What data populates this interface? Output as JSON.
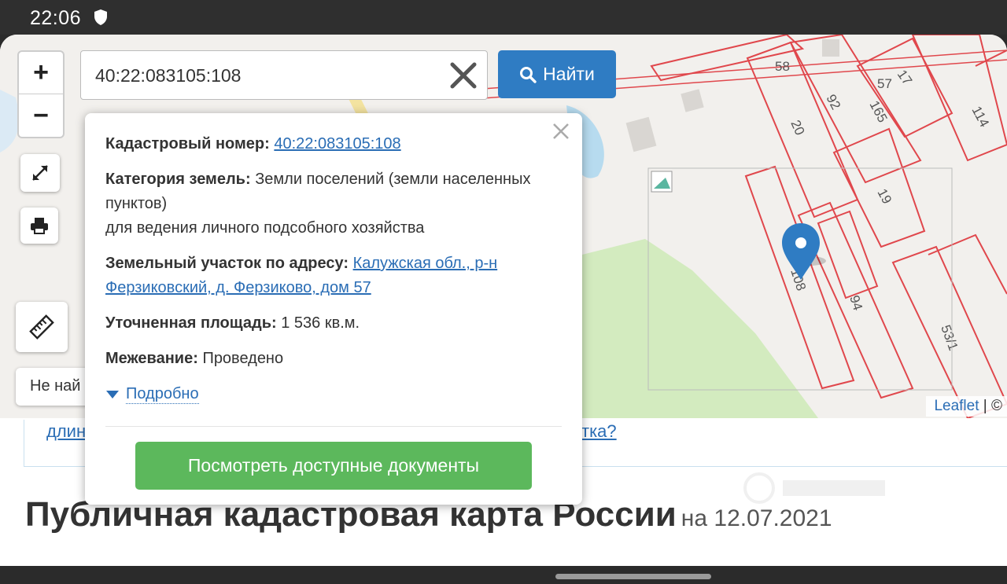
{
  "status_bar": {
    "time": "22:06",
    "icons": [
      "shield-icon"
    ]
  },
  "map": {
    "parcel_numbers": [
      "58",
      "57",
      "17",
      "92",
      "165",
      "114",
      "20",
      "19",
      "108",
      "94",
      "53/1"
    ],
    "controls": {
      "zoom_in": "+",
      "zoom_out": "−",
      "icons": [
        "fullscreen-icon",
        "print-icon",
        "ruler-icon"
      ]
    },
    "not_found_text": "Не най",
    "attribution": {
      "leaflet": "Leaflet",
      "separator": "| ©"
    }
  },
  "search": {
    "value": "40:22:083105:108",
    "button_label": "Найти"
  },
  "popup": {
    "cadastral_label": "Кадастровый номер:",
    "cadastral_value": "40:22:083105:108",
    "category_label": "Категория земель:",
    "category_value": "Земли поселений (земли населенных пунктов)",
    "category_usage": "для ведения личного подсобного хозяйства",
    "address_label": "Земельный участок по адресу:",
    "address_value": "Калужская обл., р-н Ферзиковский, д. Ферзиково, дом 57",
    "area_label": "Уточненная площадь:",
    "area_value": "1 536 кв.м.",
    "survey_label": "Межевание:",
    "survey_value": "Проведено",
    "more_label": "Подробно",
    "docs_button": "Посмотреть доступные документы"
  },
  "info_strip": {
    "text_left": "длин",
    "text_right": "тка?"
  },
  "page": {
    "title": "Публичная кадастровая карта России",
    "date": "на 12.07.2021"
  },
  "colors": {
    "accent_blue": "#2f7cc3",
    "green_button": "#5cb85c",
    "parcel_line": "#e0474c",
    "link": "#2a6db5"
  }
}
